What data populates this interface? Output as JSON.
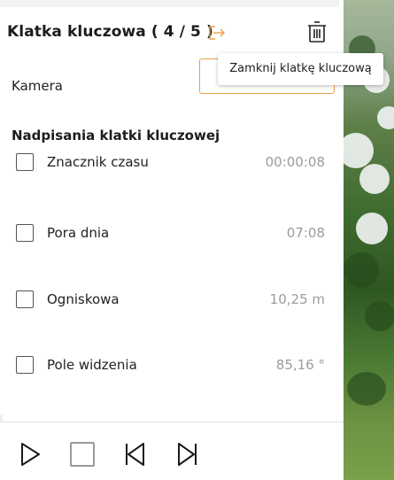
{
  "keyframe_panel": {
    "title": "Klatka kluczowa ( 4 / 5 )",
    "camera_label": "Kamera",
    "overrides_title": "Nadpisania klatki kluczowej",
    "tooltip": "Zamknij klatkę kluczową",
    "overrides": [
      {
        "label": "Znacznik czasu",
        "value": "00:00:08",
        "checked": false
      },
      {
        "label": "Pora dnia",
        "value": "07:08",
        "checked": false
      },
      {
        "label": "Ogniskowa",
        "value": "10,25  m",
        "checked": false
      },
      {
        "label": "Pole widzenia",
        "value": "85,16  °",
        "checked": false
      }
    ]
  },
  "icons": {
    "exit": "exit-icon",
    "delete": "trash-icon",
    "play": "play-icon",
    "stop": "stop-icon",
    "previous": "skip-back-icon",
    "next": "skip-forward-icon"
  },
  "colors": {
    "accent": "#e8a24a",
    "text": "#1c1c1c",
    "muted_value": "#9b9b9b"
  }
}
